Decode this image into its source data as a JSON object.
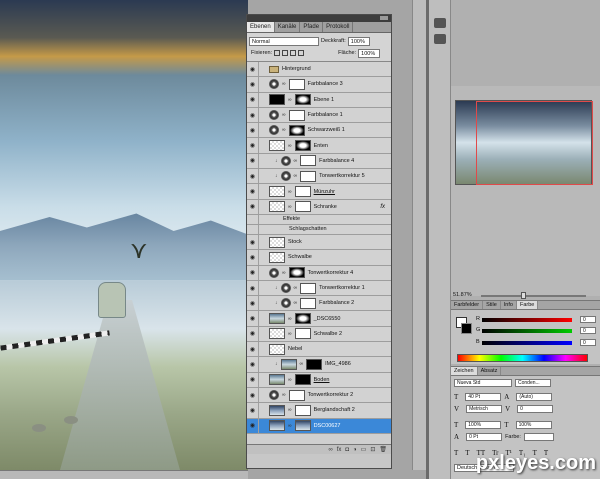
{
  "layers_panel": {
    "tabs": [
      "Ebenen",
      "Kanäle",
      "Pfade",
      "Protokoll"
    ],
    "active_tab": "Ebenen",
    "blend_mode": "Normal",
    "opacity_label": "Deckkraft:",
    "opacity_value": "100%",
    "lock_label": "Fixieren:",
    "fill_label": "Fläche:",
    "fill_value": "100%",
    "layers": [
      {
        "name": "Hintergrund",
        "kind": "group",
        "thumb": "folder"
      },
      {
        "name": "Farbbalance 3",
        "thumb": "adj",
        "mask": "white"
      },
      {
        "name": "Ebene 1",
        "thumb": "black",
        "mask": "mask"
      },
      {
        "name": "Farbbalance 1",
        "thumb": "adj",
        "mask": "white"
      },
      {
        "name": "Schwarzweiß 1",
        "thumb": "adj",
        "mask": "mask"
      },
      {
        "name": "Enten",
        "thumb": "checker",
        "mask": "mask"
      },
      {
        "name": "Farbbalance 4",
        "thumb": "adj",
        "mask": "white",
        "clipped": true
      },
      {
        "name": "Tonwertkorrektur 5",
        "thumb": "adj",
        "mask": "white",
        "clipped": true
      },
      {
        "name": "Münzuhr",
        "thumb": "checker",
        "mask": "white",
        "underline": true
      },
      {
        "name": "Schranke",
        "thumb": "checker",
        "mask": "white",
        "fx": "fx"
      },
      {
        "name": "Effekte",
        "kind": "sub"
      },
      {
        "name": "Schlagschatten",
        "kind": "sub2"
      },
      {
        "name": "Stock",
        "thumb": "checker"
      },
      {
        "name": "Schwalbe",
        "thumb": "checker"
      },
      {
        "name": "Tonwertkorrektur 4",
        "thumb": "adj",
        "mask": "mask"
      },
      {
        "name": "Tonwertkorrektur 1",
        "thumb": "adj",
        "mask": "white",
        "clipped": true
      },
      {
        "name": "Farbbalance 2",
        "thumb": "adj",
        "mask": "white",
        "clipped": true
      },
      {
        "name": "_DSC6550",
        "thumb": "photo",
        "mask": "mask"
      },
      {
        "name": "Schwalbe 2",
        "thumb": "checker",
        "mask": "white"
      },
      {
        "name": "Nebel",
        "thumb": "checker"
      },
      {
        "name": "IMG_4986",
        "thumb": "photo",
        "mask": "black",
        "clipped": true
      },
      {
        "name": "Boden",
        "thumb": "photo",
        "mask": "black",
        "underline": true
      },
      {
        "name": "Tonwertkorrektur 2",
        "thumb": "adj",
        "mask": "white"
      },
      {
        "name": "Berglandschaft 2",
        "thumb": "landscape",
        "mask": "white"
      },
      {
        "name": "DSC00627",
        "thumb": "landscape",
        "mask": "landscape",
        "selected": true
      }
    ],
    "bottom_icons": [
      "∞",
      "fx",
      "◘",
      "◑",
      "▭",
      "⊡",
      "🗑"
    ]
  },
  "navigator": {
    "zoom": "51.87%"
  },
  "color_panel": {
    "tabs": [
      "Farbfelder",
      "Stile",
      "Info",
      "Farbe"
    ],
    "active_tab": "Farbe",
    "channels": [
      {
        "label": "R",
        "value": "0",
        "color": "#e02020"
      },
      {
        "label": "G",
        "value": "0",
        "color": "#20b020"
      },
      {
        "label": "B",
        "value": "0",
        "color": "#2030e0"
      }
    ]
  },
  "character_panel": {
    "tabs": [
      "Zeichen",
      "Absatz"
    ],
    "active_tab": "Zeichen",
    "font_family": "Nueva Std",
    "font_style": "Conden...",
    "font_size": "40 Pt",
    "leading": "(Auto)",
    "kerning": "Metrisch",
    "tracking": "0",
    "vertical_scale": "100%",
    "horizontal_scale": "100%",
    "baseline": "0 Pt",
    "color_label": "Farbe:",
    "type_buttons": [
      "T",
      "T",
      "TT",
      "Tr",
      "T¹",
      "T₁",
      "T",
      "T"
    ],
    "language": "Deutsch: neue R"
  },
  "watermark": "pxleyes.com"
}
